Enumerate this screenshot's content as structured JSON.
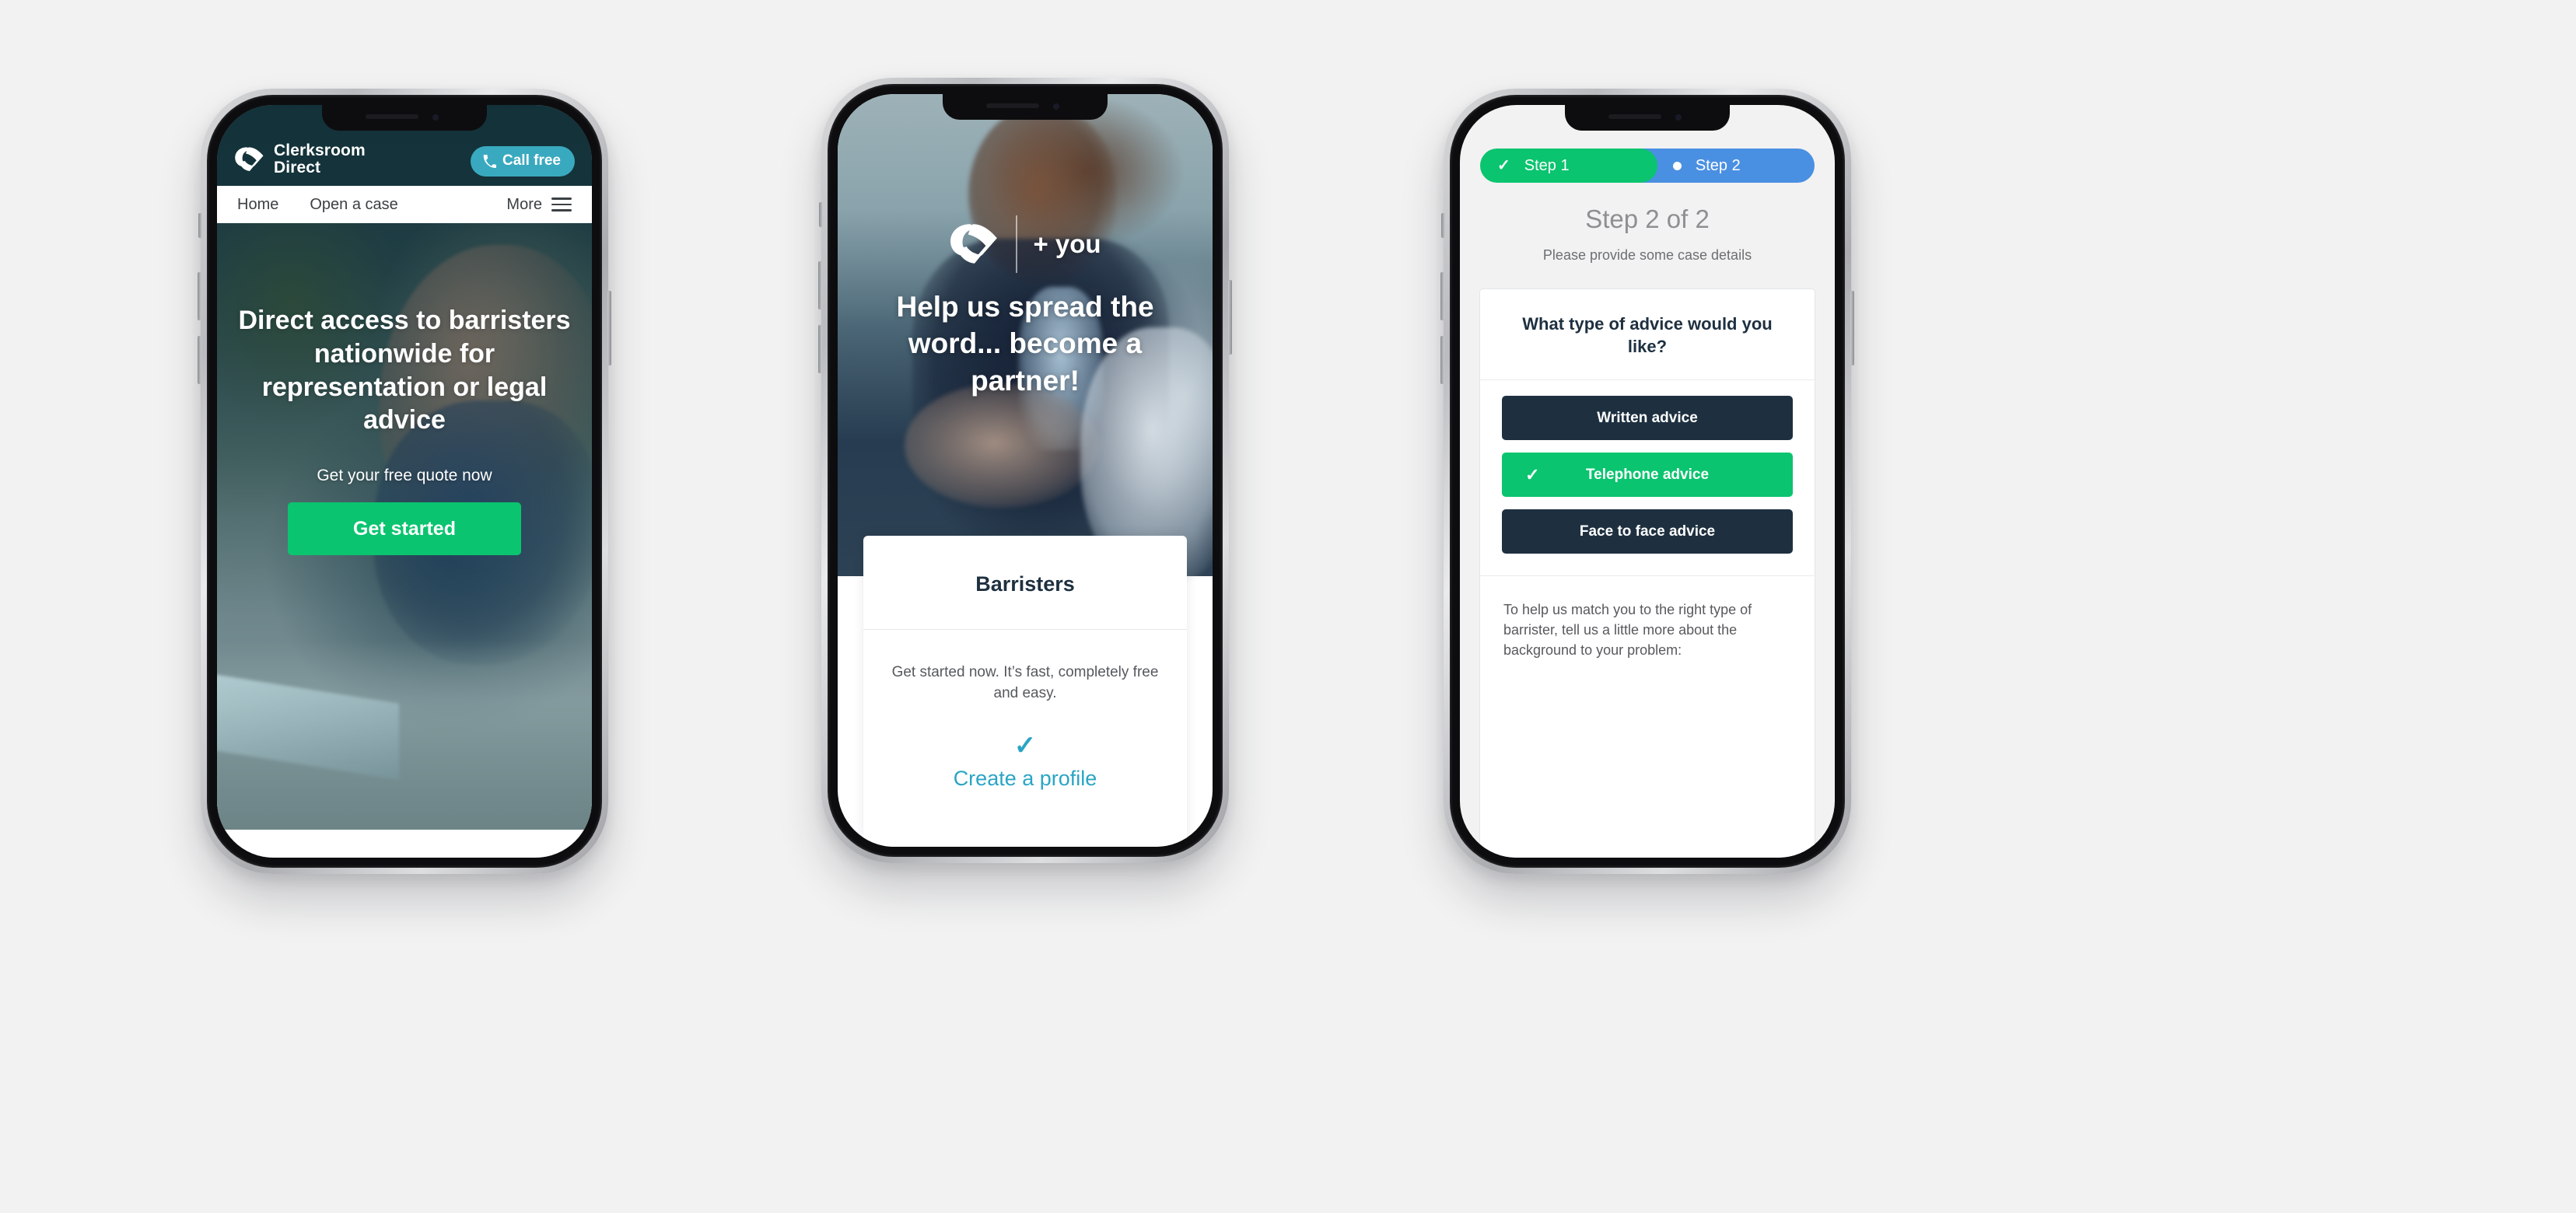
{
  "canvas": {
    "background": "#f2f2f2"
  },
  "colors": {
    "green": "#0ac46f",
    "teal": "#39a9bf",
    "navy": "#1e3040",
    "blue": "#4a90e2",
    "link": "#2aa5c4"
  },
  "phone1": {
    "brand": {
      "line1": "Clerksroom",
      "line2": "Direct",
      "logo_icon": "clerksroom-logo-icon"
    },
    "call_button": {
      "label": "Call free",
      "icon": "phone-icon"
    },
    "nav": {
      "items": [
        "Home",
        "Open a case"
      ],
      "more_label": "More",
      "more_icon": "hamburger-icon"
    },
    "hero": {
      "headline": "Direct access to barristers nationwide for representation or legal advice",
      "subtitle": "Get your free quote now",
      "cta_label": "Get started"
    }
  },
  "phone2": {
    "logo_icon": "clerksroom-logo-icon",
    "plus_you": "+ you",
    "headline": "Help us spread the word... become a partner!",
    "card": {
      "title": "Barristers",
      "body": "Get started now. It’s fast, completely free\nand easy.",
      "check_icon": "check-icon",
      "link_label": "Create a profile"
    }
  },
  "phone3": {
    "steps": [
      {
        "label": "Step 1",
        "icon": "check-icon",
        "state": "complete",
        "color": "#0ac46f"
      },
      {
        "label": "Step 2",
        "icon": "dot-icon",
        "state": "current",
        "color": "#4a90e2"
      }
    ],
    "title": "Step 2 of 2",
    "subtitle": "Please provide some case details",
    "question": "What type of advice would you like?",
    "options": [
      {
        "label": "Written advice",
        "selected": false
      },
      {
        "label": "Telephone advice",
        "selected": true,
        "icon": "check-icon"
      },
      {
        "label": "Face to face advice",
        "selected": false
      }
    ],
    "footer_text": "To help us match you to the right type of barrister, tell us a little more about the background to your problem:"
  }
}
